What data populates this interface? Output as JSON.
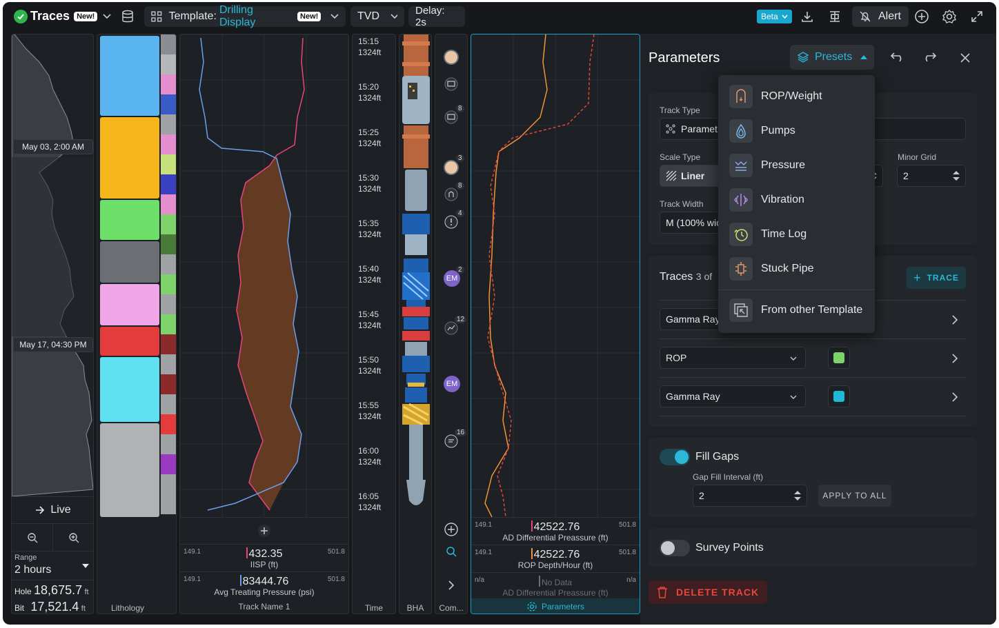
{
  "header": {
    "app_title": "Traces",
    "new_badge": "New!",
    "template_prefix": "Template:",
    "template_name": "Drilling Display",
    "template_badge": "New!",
    "depth_mode": "TVD",
    "delay": "Delay: 2s",
    "beta": "Beta",
    "alert": "Alert"
  },
  "overview": {
    "date1": "May 03, 2:00 AM",
    "date2": "May 17, 04:30 PM",
    "live": "Live",
    "range_label": "Range",
    "range_value": "2 hours",
    "hole_label": "Hole",
    "hole_value": "18,675.7",
    "hole_unit": "ft",
    "bit_label": "Bit",
    "bit_value": "17,521.4",
    "bit_unit": "ft"
  },
  "lithology": {
    "label": "Lithology"
  },
  "track1": {
    "name": "Track Name 1",
    "values": [
      {
        "min": "149.1",
        "max": "501.8",
        "value": "432.35",
        "name": "IISP (ft)",
        "color": "#e8457a"
      },
      {
        "min": "149.1",
        "max": "501.8",
        "value": "83444.76",
        "name": "Avg Treating Pressure (psi)",
        "color": "#6a9ff0"
      }
    ]
  },
  "time": {
    "label": "Time",
    "ticks": [
      {
        "t": "15:15",
        "d": "1324ft"
      },
      {
        "t": "15:20",
        "d": "1324ft"
      },
      {
        "t": "15:25",
        "d": "1324ft"
      },
      {
        "t": "15:30",
        "d": "1324ft"
      },
      {
        "t": "15:35",
        "d": "1324ft"
      },
      {
        "t": "15:40",
        "d": "1324ft"
      },
      {
        "t": "15:45",
        "d": "1324ft"
      },
      {
        "t": "15:50",
        "d": "1324ft"
      },
      {
        "t": "15:55",
        "d": "1324ft"
      },
      {
        "t": "16:00",
        "d": "1324ft"
      },
      {
        "t": "16:05",
        "d": "1324ft"
      }
    ]
  },
  "bha": {
    "label": "BHA"
  },
  "comments": {
    "label": "Com...",
    "badges": [
      "8",
      "3",
      "8",
      "4",
      "2",
      "12",
      "16"
    ],
    "initials": "EM"
  },
  "track2": {
    "label": "Parameters",
    "values": [
      {
        "min": "149.1",
        "max": "501.8",
        "value": "42522.76",
        "name": "AD Differential Preassure (ft)",
        "color": "#e8457a"
      },
      {
        "min": "149.1",
        "max": "501.8",
        "value": "42522.76",
        "name": "ROP Depth/Hour (ft)",
        "color": "#f2943a"
      },
      {
        "min": "n/a",
        "max": "n/a",
        "value": "No Data",
        "name": "AD Differential Preassure (ft)",
        "color": "#6b7077"
      }
    ]
  },
  "params": {
    "title": "Parameters",
    "presets": "Presets",
    "track_type_label": "Track Type",
    "track_type_value": "Paramet",
    "scale_type_label": "Scale Type",
    "scale_value": "Liner",
    "minor_grid_label": "Minor Grid",
    "minor_grid_value": "2",
    "track_width_label": "Track Width",
    "track_width_value": "M (100% wic",
    "traces_title": "Traces",
    "traces_count": "3 of",
    "add_trace": "TRACE",
    "trace_rows": [
      {
        "name": "Gamma Ray"
      },
      {
        "name": "ROP",
        "color": "#7ed36a"
      },
      {
        "name": "Gamma Ray",
        "color": "#1fb9d6"
      }
    ],
    "fill_gaps": "Fill Gaps",
    "gap_label": "Gap Fill Interval (ft)",
    "gap_value": "2",
    "apply_all": "APPLY TO ALL",
    "survey_points": "Survey Points",
    "delete_track": "DELETE TRACK"
  },
  "presets_menu": {
    "items": [
      "ROP/Weight",
      "Pumps",
      "Pressure",
      "Vibration",
      "Time Log",
      "Stuck Pipe",
      "From other Template"
    ]
  }
}
